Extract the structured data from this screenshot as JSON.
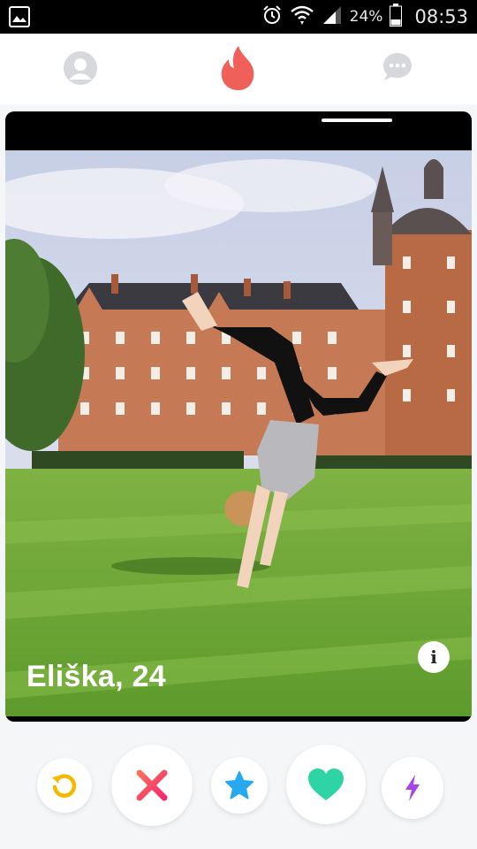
{
  "status_bar": {
    "battery": "24%",
    "time": "08:53",
    "icons": [
      "image-notification-icon",
      "alarm-icon",
      "wifi-icon",
      "signal-icon",
      "battery-icon"
    ]
  },
  "nav": {
    "icons": [
      "profile-icon",
      "flame-icon",
      "messages-icon"
    ],
    "colors": {
      "inactive": "#d6d8dc",
      "brand": "#f0605a"
    }
  },
  "card": {
    "name_age": "Eliška, 24",
    "info_glyph": "i",
    "photo_count_indicator": "1"
  },
  "actions": {
    "rewind": {
      "icon": "rewind-icon",
      "color": "#f5b800"
    },
    "nope": {
      "icon": "x-icon",
      "color": "#f5466b"
    },
    "super_like": {
      "icon": "star-icon",
      "color": "#27a9ef"
    },
    "like": {
      "icon": "heart-icon",
      "color": "#2fd4a4"
    },
    "boost": {
      "icon": "bolt-icon",
      "color": "#a545e8"
    }
  }
}
